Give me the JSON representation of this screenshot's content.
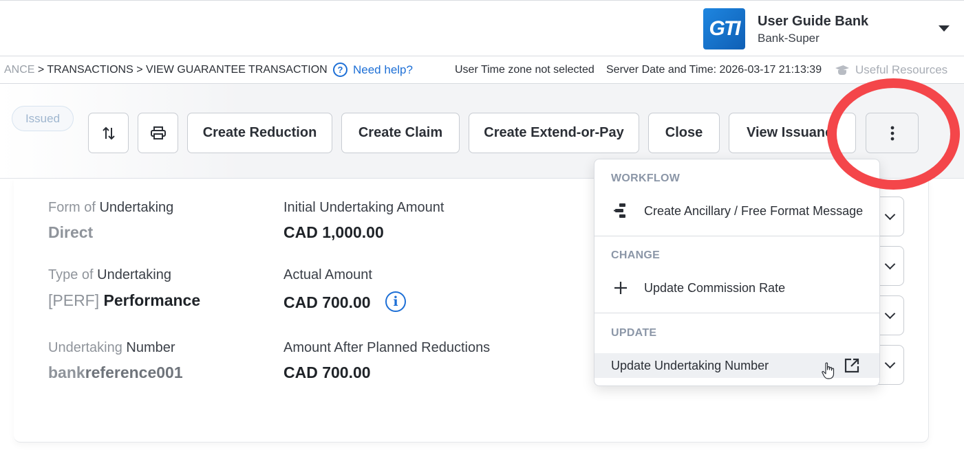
{
  "header": {
    "logo_text": "GTI",
    "bank_name": "User Guide Bank",
    "user_role": "Bank-Super"
  },
  "breadcrumb": {
    "faded_prefix": "ANCE",
    "path": " > TRANSACTIONS > VIEW GUARANTEE TRANSACTION",
    "help_label": "Need help?",
    "timezone_text": "User Time zone not selected",
    "server_time": "Server Date and Time: 2026-03-17 21:13:39",
    "resources_label": "Useful Resources"
  },
  "actions": {
    "status": "Issued",
    "create_reduction": "Create Reduction",
    "create_claim": "Create Claim",
    "create_extend_or_pay": "Create Extend-or-Pay",
    "close": "Close",
    "view_issuance": "View Issuanc"
  },
  "details": {
    "form_label_a": "Form of ",
    "form_label_b": "Undertaking",
    "form_value": "Direct",
    "type_label_a": "Type of ",
    "type_label_b": "Undertaking",
    "type_value_code": "[PERF]",
    "type_value": " Performance",
    "number_label_a": "Undertaking ",
    "number_label_b": "Number",
    "number_value_a": "bank",
    "number_value_b": "reference001",
    "initial_amount_label": "Initial Undertaking Amount",
    "initial_amount_value": "CAD 1,000.00",
    "actual_amount_label": "Actual Amount",
    "actual_amount_value": "CAD 700.00",
    "after_reductions_label": "Amount After Planned Reductions",
    "after_reductions_value": "CAD 700.00"
  },
  "menu": {
    "sections": [
      {
        "title": "WORKFLOW",
        "item": "Create Ancillary / Free Format Message"
      },
      {
        "title": "CHANGE",
        "item": "Update Commission Rate"
      },
      {
        "title": "UPDATE",
        "item": "Update Undertaking Number"
      }
    ]
  },
  "colors": {
    "accent_blue": "#1d6fd6",
    "annotation_red": "#f4464a",
    "section_title": "#8b96a7"
  },
  "icons": [
    "sort-icon",
    "print-icon",
    "kebab-menu-icon",
    "help-circle-icon",
    "graduation-cap-icon",
    "info-icon",
    "message-flow-icon",
    "plus-icon",
    "external-link-icon",
    "hand-cursor-icon",
    "chevron-down-icon"
  ]
}
